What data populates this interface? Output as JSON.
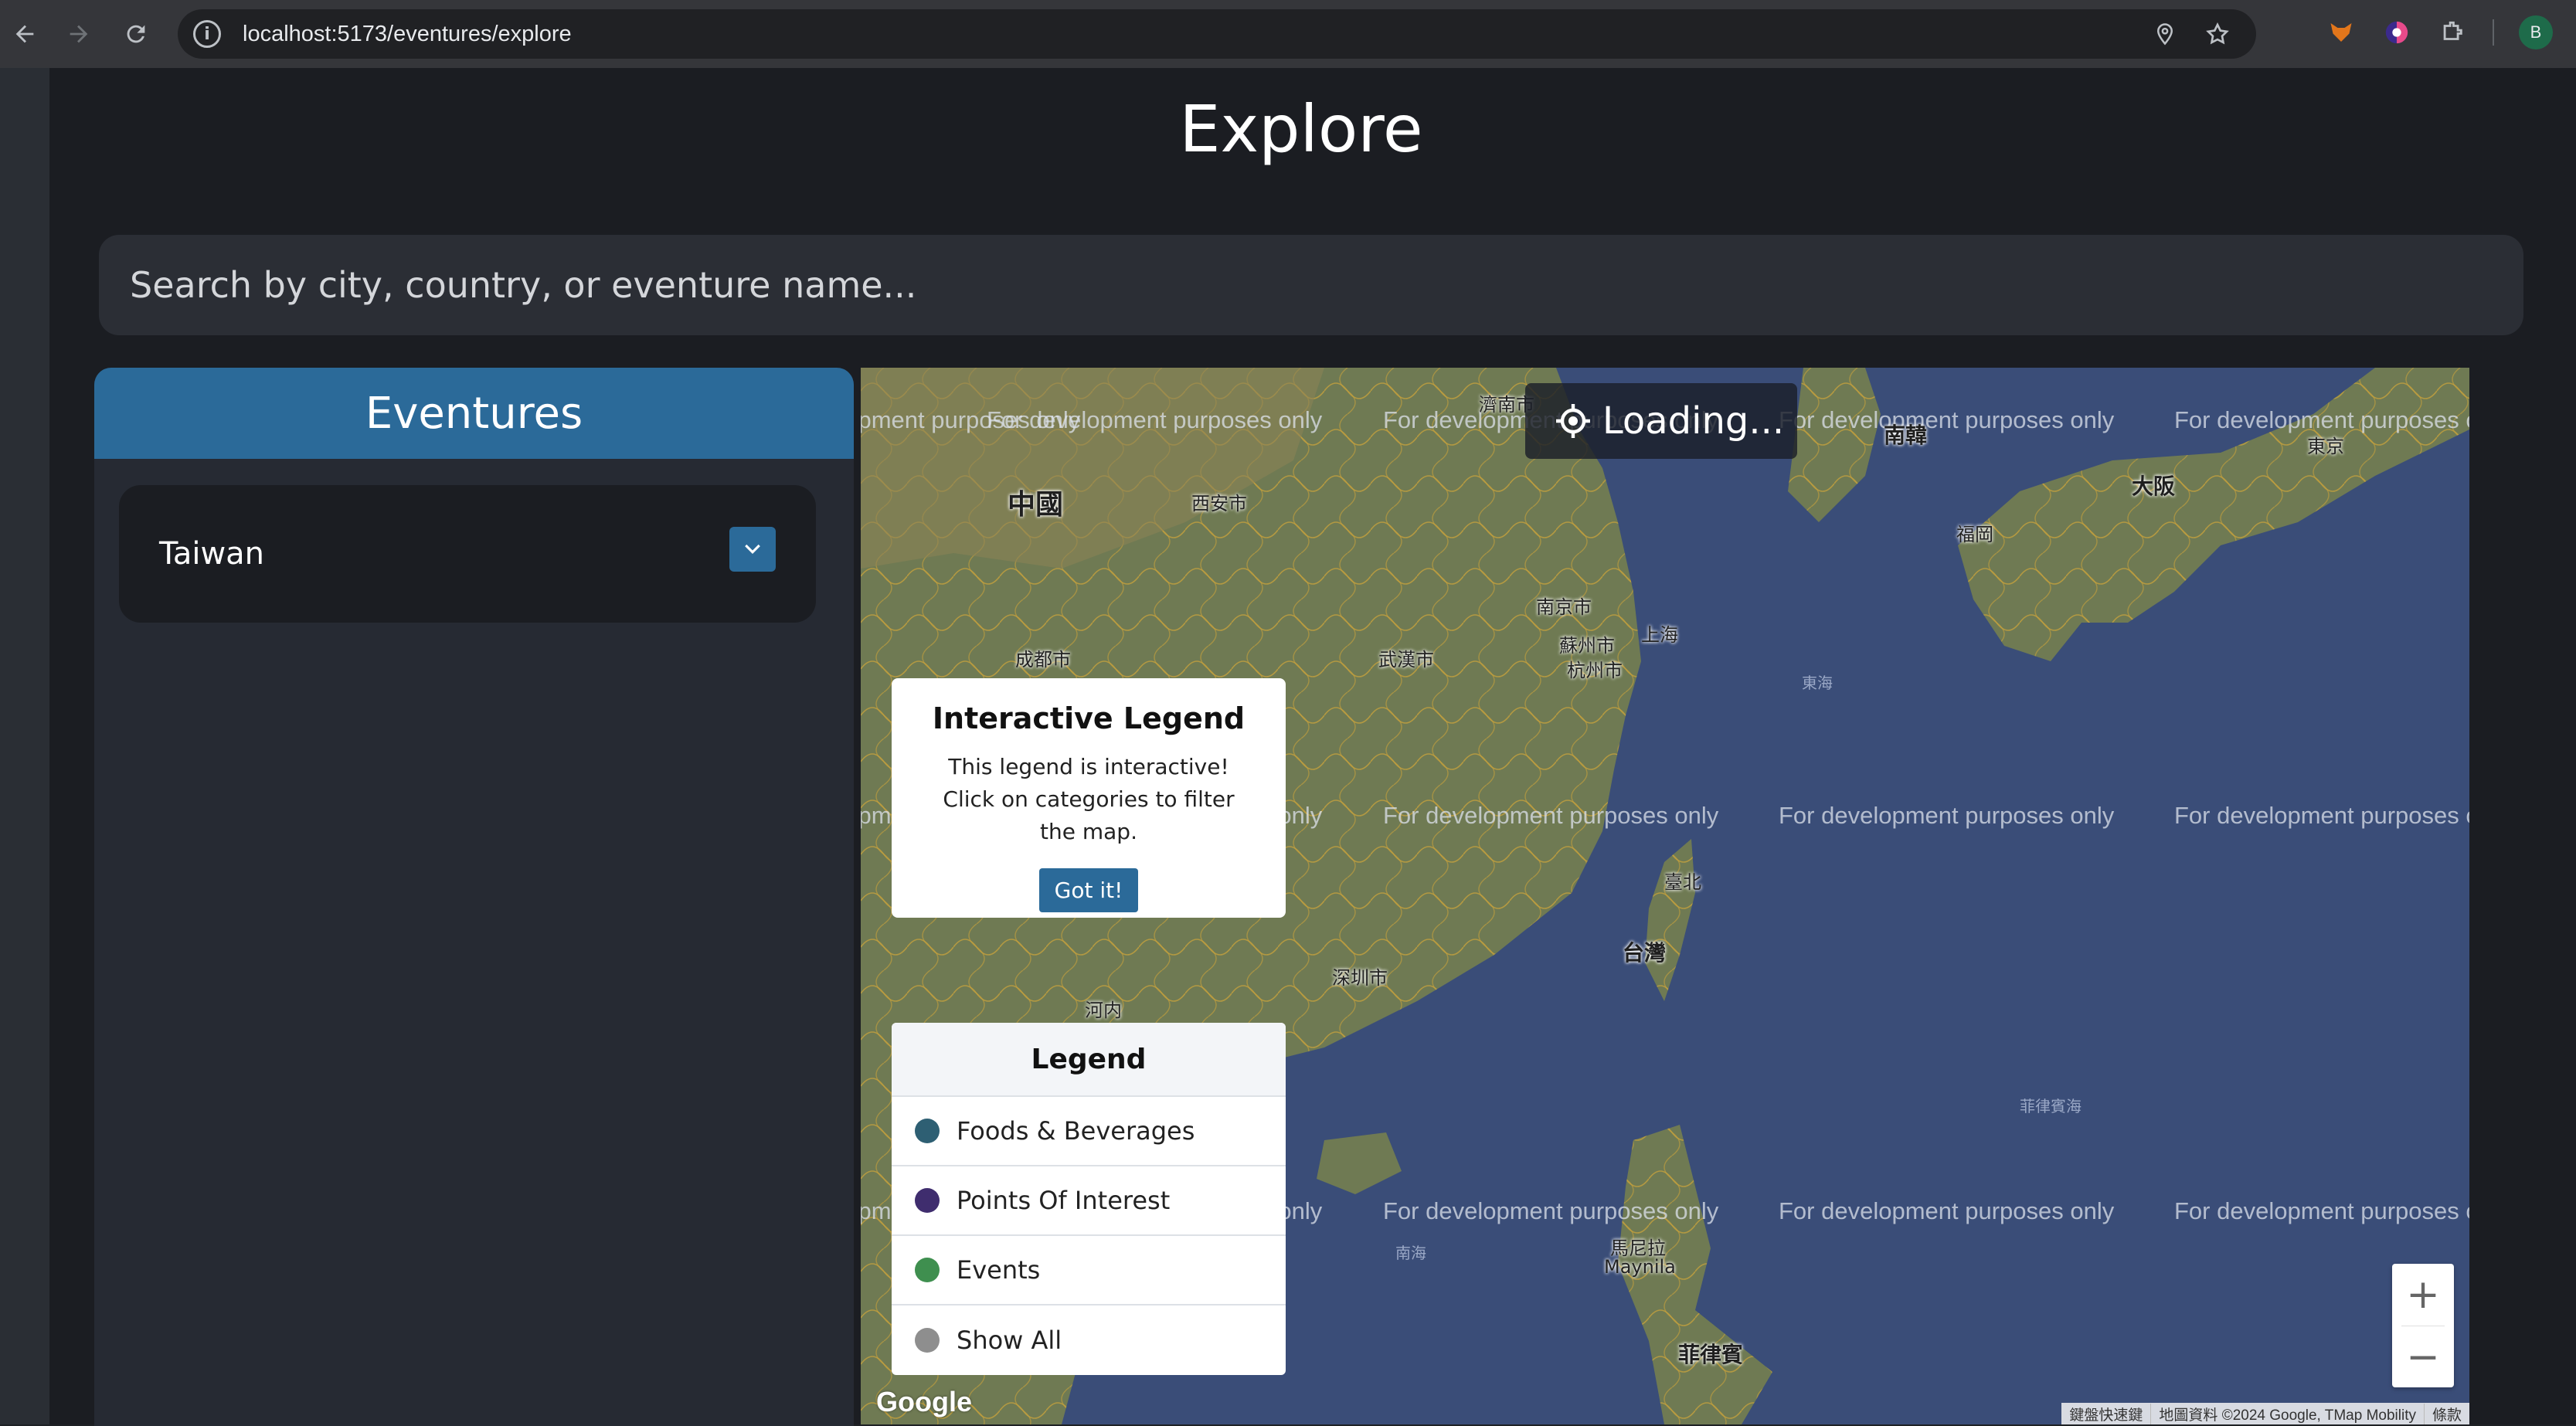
{
  "browser": {
    "url": "localhost:5173/eventures/explore",
    "avatar_letter": "B"
  },
  "page": {
    "title": "Explore",
    "search_placeholder": "Search by city, country, or eventure name..."
  },
  "eventures_panel": {
    "header": "Eventures",
    "countries": [
      {
        "name": "Taiwan"
      }
    ]
  },
  "map": {
    "loading_text": "Loading...",
    "watermark": "For development purposes only",
    "google_label": "Google",
    "attribution": {
      "shortcuts": "鍵盤快速鍵",
      "data": "地圖資料 ©2024 Google, TMap Mobility",
      "terms": "條款"
    },
    "places": [
      {
        "label": "中國"
      },
      {
        "label": "西安市"
      },
      {
        "label": "成都市"
      },
      {
        "label": "武漢市"
      },
      {
        "label": "南京市"
      },
      {
        "label": "蘇州市"
      },
      {
        "label": "上海"
      },
      {
        "label": "杭州市"
      },
      {
        "label": "深圳市"
      },
      {
        "label": "臺北"
      },
      {
        "label": "台灣"
      },
      {
        "label": "濟南市"
      },
      {
        "label": "南韓"
      },
      {
        "label": "大阪"
      },
      {
        "label": "福岡"
      },
      {
        "label": "東京"
      },
      {
        "label": "馬尼拉"
      },
      {
        "label": "Maynila"
      },
      {
        "label": "菲律賓"
      },
      {
        "label": "河内"
      },
      {
        "label": "東海"
      },
      {
        "label": "菲律賓海"
      },
      {
        "label": "南海"
      }
    ]
  },
  "interactive_legend_popup": {
    "title": "Interactive Legend",
    "body": "This legend is interactive! Click on categories to filter the map.",
    "button": "Got it!"
  },
  "legend": {
    "title": "Legend",
    "items": [
      {
        "label": "Foods & Beverages",
        "color": "#2e5f73"
      },
      {
        "label": "Points Of Interest",
        "color": "#3f2d6e"
      },
      {
        "label": "Events",
        "color": "#3f8f4f"
      },
      {
        "label": "Show All",
        "color": "#8e8e8e"
      }
    ]
  },
  "zoom": {
    "in": "+",
    "out": "−"
  }
}
